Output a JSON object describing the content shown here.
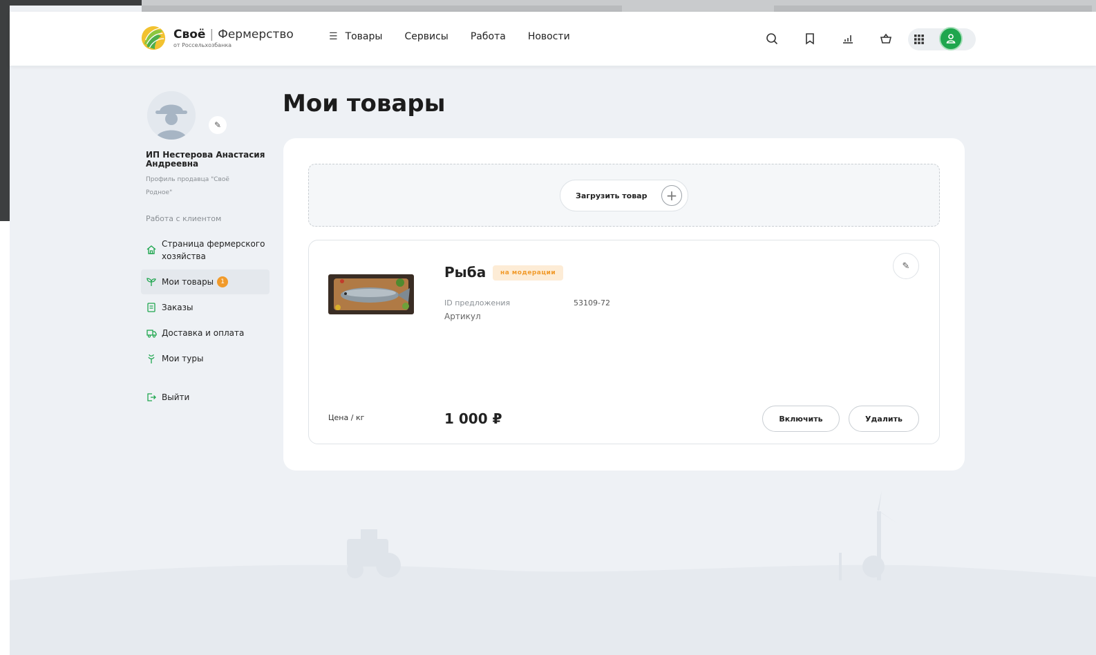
{
  "header": {
    "logo": {
      "brand": "Своё",
      "name": "Фермерство",
      "tagline": "от Россельхозбанка"
    },
    "nav": [
      {
        "label": "Товары"
      },
      {
        "label": "Сервисы"
      },
      {
        "label": "Работа"
      },
      {
        "label": "Новости"
      }
    ],
    "icons": [
      "search-icon",
      "bookmark-icon",
      "chart-icon",
      "cart-icon",
      "apps-grid-icon",
      "user-icon"
    ],
    "accent_color": "#1ea64e"
  },
  "sidebar": {
    "name": "ИП Нестерова Анастасия Андреевна",
    "description": "Профиль продавца \"Своё Родное\"",
    "section": "Работа с клиентом",
    "items": [
      {
        "label": "Страница фермерского хозяйства",
        "icon": "house-icon"
      },
      {
        "label": "Мои товары",
        "icon": "sprout-icon",
        "badge": "1",
        "active": true
      },
      {
        "label": "Заказы",
        "icon": "document-icon"
      },
      {
        "label": "Доставка и оплата",
        "icon": "delivery-icon"
      },
      {
        "label": "Мои туры",
        "icon": "tour-icon"
      }
    ],
    "logout": "Выйти"
  },
  "main": {
    "title": "Мои товары",
    "upload_label": "Загрузить товар",
    "product": {
      "name": "Рыба",
      "status": "на модерации",
      "status_color": "#f19a2a",
      "offer_id_label": "ID предложения",
      "offer_id_value": "53109-72",
      "sku_label": "Артикул",
      "price_label": "Цена / кг",
      "price": "1 000 ₽",
      "enable_label": "Включить",
      "delete_label": "Удалить"
    }
  }
}
